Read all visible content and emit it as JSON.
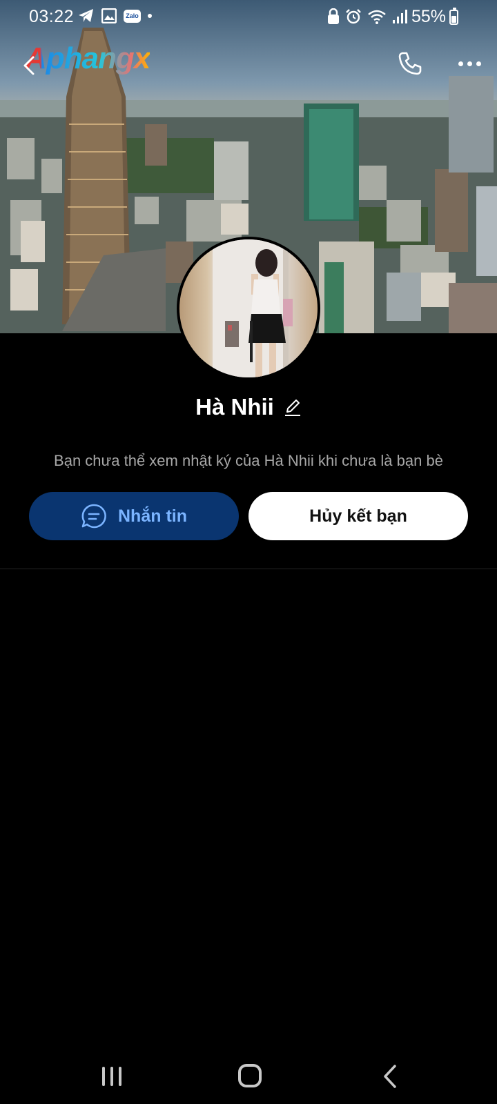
{
  "status_bar": {
    "time": "03:22",
    "battery_percent": "55%",
    "battery_level": 0.55,
    "left_icons": [
      "telegram-icon",
      "gallery-icon",
      "zalo-icon",
      "notification-dot"
    ],
    "right_icons": [
      "vpn-lock-icon",
      "alarm-icon",
      "wifi-icon",
      "signal-icon",
      "battery-icon"
    ],
    "zalo_label": "Zalo"
  },
  "header": {
    "watermark": "Aphangx",
    "actions": [
      "back-icon",
      "phone-icon",
      "more-icon"
    ]
  },
  "profile": {
    "name": "Hà Nhii",
    "notice": "Bạn chưa thể xem nhật ký của Hà Nhii khi chưa là bạn bè"
  },
  "actions": {
    "message_label": "Nhắn tin",
    "unfriend_label": "Hủy kết bạn"
  },
  "colors": {
    "message_button_bg": "#0a3570",
    "message_button_text": "#7bb4ff",
    "unfriend_button_bg": "#ffffff",
    "background": "#000000"
  },
  "nav_bar": {
    "buttons": [
      "recents-icon",
      "home-icon",
      "back-icon"
    ]
  }
}
